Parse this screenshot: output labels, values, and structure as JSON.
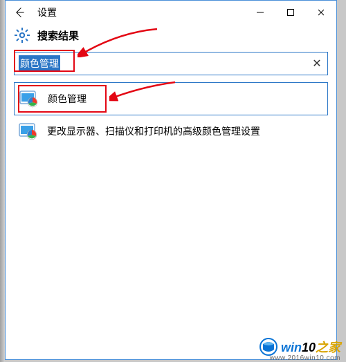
{
  "window": {
    "title": "设置"
  },
  "header": {
    "title": "搜索结果"
  },
  "search": {
    "value": "颜色管理"
  },
  "results": [
    {
      "title": "颜色管理",
      "selected": true
    },
    {
      "title": "更改显示器、扫描仪和打印机的高级颜色管理设置",
      "selected": false
    }
  ],
  "watermark": {
    "brand_pre": "win",
    "brand_num": "10",
    "brand_suf": "之家",
    "url": "www.2016win10.com"
  }
}
